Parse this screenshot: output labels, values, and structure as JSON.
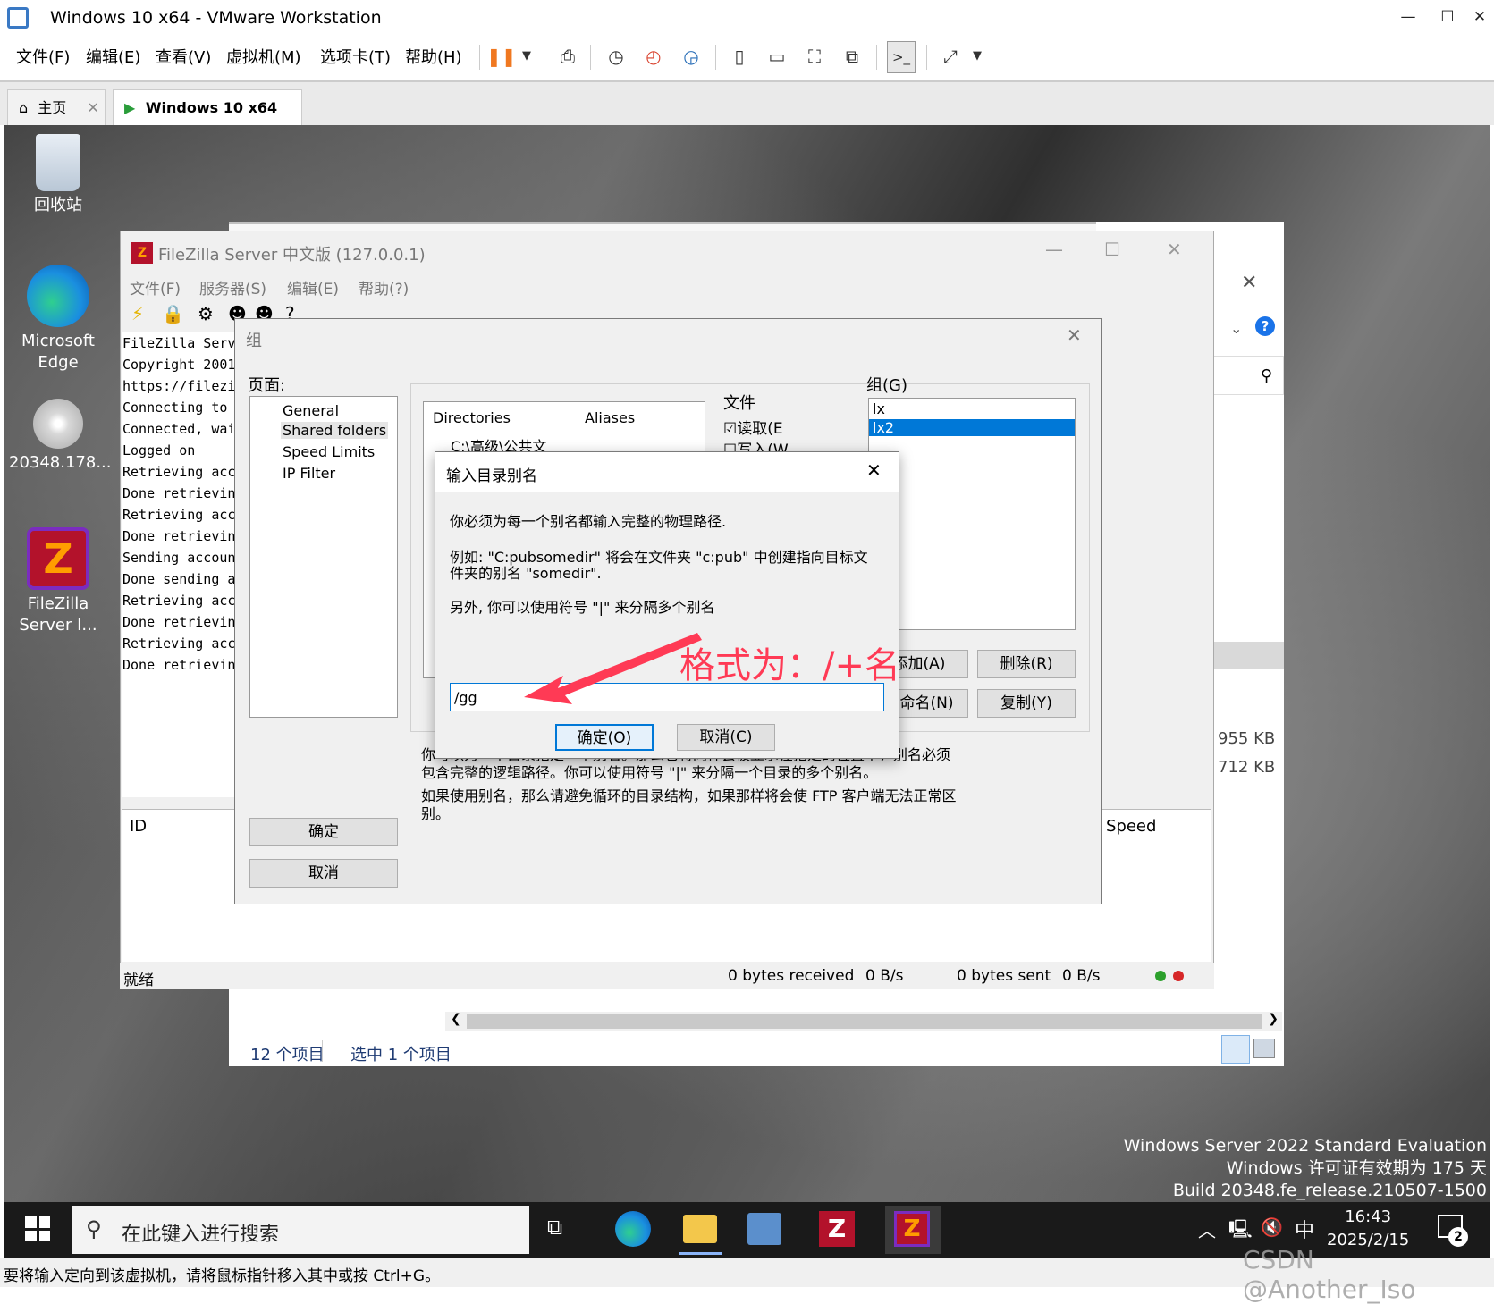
{
  "vmware": {
    "window_title": "Windows 10 x64 - VMware Workstation",
    "menu": [
      "文件(F)",
      "编辑(E)",
      "查看(V)",
      "虚拟机(M)",
      "选项卡(T)",
      "帮助(H)"
    ],
    "tabs": [
      {
        "label": "主页"
      },
      {
        "label": "Windows 10 x64"
      }
    ],
    "status_text": "要将输入定向到该虚拟机，请将鼠标指针移入其中或按 Ctrl+G。"
  },
  "desktop": {
    "icons": [
      {
        "label": "回收站"
      },
      {
        "label": "Microsoft Edge"
      },
      {
        "label": "20348.178..."
      },
      {
        "label": "FileZilla Server I..."
      }
    ],
    "watermark": [
      "Windows Server 2022 Standard Evaluation",
      "Windows 许可证有效期为 175 天",
      "Build 20348.fe_release.210507-1500"
    ],
    "csdn": "CSDN @Another_Iso"
  },
  "explorer": {
    "items_count": "12 个项目",
    "selected": "选中 1 个项目",
    "sizes": [
      "955 KB",
      "712 KB"
    ]
  },
  "filezilla": {
    "title": "FileZilla Server 中文版 (127.0.0.1)",
    "menu": [
      "文件(F)",
      "服务器(S)",
      "编辑(E)",
      "帮助(?)"
    ],
    "log": [
      "FileZilla Serv",
      "Copyright 2001",
      "https://filezi",
      "Connecting to",
      "Connected, wai",
      "Logged on",
      "Retrieving acc",
      "Done retrievin",
      "Retrieving acc",
      "Done retrievin",
      "Sending accoun",
      "Done sending a",
      "Retrieving acc",
      "Done retrievin",
      "Retrieving acc",
      "Done retrievin"
    ],
    "queue_headers": {
      "id": "ID",
      "speed": "Speed"
    },
    "status": {
      "ready": "就绪",
      "received": "0 bytes received",
      "recv_rate": "0 B/s",
      "sent": "0 bytes sent",
      "sent_rate": "0 B/s"
    }
  },
  "group_dialog": {
    "title": "组",
    "pages_label": "页面:",
    "pages": [
      "General",
      "Shared folders",
      "Speed Limits",
      "IP Filter"
    ],
    "selected_page": "Shared folders",
    "columns": {
      "directories": "Directories",
      "aliases": "Aliases"
    },
    "directory_row": "C:\\高级\\公共文",
    "files_label": "文件",
    "read_label": "读取(E",
    "write_label": "写入(W",
    "groups_label": "组(G)",
    "groups": [
      "lx",
      "lx2"
    ],
    "selected_group": "lx2",
    "buttons": {
      "add": "添加(A)",
      "delete": "删除(R)",
      "rename": "重命名(N)",
      "copy": "复制(Y)",
      "ok": "确定",
      "cancel": "取消"
    },
    "help_lines": [
      "你可以为一个目录指定一个别名。那么它将同样会被显示在指定的位置中，别名必须",
      "包含完整的逻辑路径。你可以使用符号 \"|\" 来分隔一个目录的多个别名。",
      "如果使用别名，那么请避免循环的目录结构，如果那样将会使 FTP 客户端无法正常区",
      "别。"
    ]
  },
  "alias_dialog": {
    "title": "输入目录别名",
    "line1": "你必须为每一个别名都输入完整的物理路径.",
    "line2a": "例如: \"C:pubsomedir\" 将会在文件夹 \"c:pub\" 中创建指向目标文",
    "line2b": "件夹的别名 \"somedir\".",
    "line3": "另外, 你可以使用符号 \"|\" 来分隔多个别名",
    "input_value": "/gg",
    "ok": "确定(O)",
    "cancel": "取消(C)"
  },
  "annotation": {
    "text": "格式为：/+名",
    "color": "#ff3a55"
  },
  "taskbar": {
    "search_placeholder": "在此键入进行搜索",
    "time": "16:43",
    "date": "2025/2/15",
    "ime": "中",
    "notification_count": "2"
  }
}
